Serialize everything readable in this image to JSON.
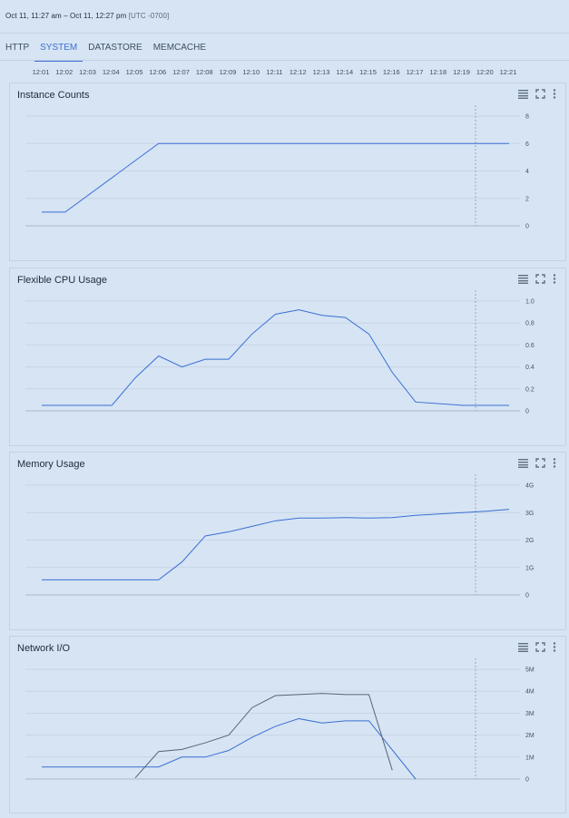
{
  "header": {
    "date_range": "Oct 11, 11:27 am – Oct 11, 12:27 pm",
    "timezone": "[UTC -0700]"
  },
  "tabs": [
    {
      "label": "HTTP",
      "active": false
    },
    {
      "label": "SYSTEM",
      "active": true
    },
    {
      "label": "DATASTORE",
      "active": false
    },
    {
      "label": "MEMCACHE",
      "active": false
    }
  ],
  "time_axis": [
    "12:01",
    "12:02",
    "12:03",
    "12:04",
    "12:05",
    "12:06",
    "12:07",
    "12:08",
    "12:09",
    "12:10",
    "12:11",
    "12:12",
    "12:13",
    "12:14",
    "12:15",
    "12:16",
    "12:17",
    "12:18",
    "12:19",
    "12:20",
    "12:21"
  ],
  "panel_icons": [
    "legend-icon",
    "fullscreen-icon",
    "more-vert-icon"
  ],
  "colors": {
    "line_primary": "#3b6fd1",
    "line_secondary": "#56657a",
    "grid": "#c6d4e5",
    "cursor": "#9aa9bb"
  },
  "chart_data": [
    {
      "title": "Instance Counts",
      "type": "line",
      "ylim": [
        0,
        8
      ],
      "yticks": [
        "0",
        "2",
        "4",
        "6",
        "8"
      ],
      "x": [
        "12:01",
        "12:02",
        "12:06",
        "12:21"
      ],
      "series": [
        {
          "values": [
            1,
            1,
            6,
            6
          ]
        }
      ]
    },
    {
      "title": "Flexible CPU Usage",
      "type": "line",
      "ylim": [
        0,
        1.0
      ],
      "yticks": [
        "0",
        "0.2",
        "0.4",
        "0.6",
        "0.8",
        "1.0"
      ],
      "x": [
        "12:01",
        "12:04",
        "12:05",
        "12:06",
        "12:07",
        "12:08",
        "12:09",
        "12:10",
        "12:11",
        "12:12",
        "12:13",
        "12:14",
        "12:15",
        "12:16",
        "12:17",
        "12:19",
        "12:21"
      ],
      "series": [
        {
          "values": [
            0.05,
            0.05,
            0.3,
            0.5,
            0.4,
            0.47,
            0.47,
            0.7,
            0.88,
            0.92,
            0.87,
            0.85,
            0.7,
            0.35,
            0.08,
            0.05,
            0.05
          ]
        }
      ]
    },
    {
      "title": "Memory Usage",
      "type": "line",
      "ylim": [
        0,
        4
      ],
      "yticks": [
        "0",
        "1G",
        "2G",
        "3G",
        "4G"
      ],
      "x": [
        "12:01",
        "12:06",
        "12:07",
        "12:08",
        "12:09",
        "12:10",
        "12:11",
        "12:12",
        "12:13",
        "12:14",
        "12:15",
        "12:16",
        "12:17",
        "12:18",
        "12:19",
        "12:20",
        "12:21"
      ],
      "series": [
        {
          "values": [
            0.55,
            0.55,
            1.2,
            2.15,
            2.3,
            2.5,
            2.7,
            2.8,
            2.8,
            2.82,
            2.8,
            2.82,
            2.9,
            2.95,
            3.0,
            3.05,
            3.12
          ]
        }
      ]
    },
    {
      "title": "Network I/O",
      "type": "line",
      "ylim": [
        0,
        5
      ],
      "yticks": [
        "0",
        "1M",
        "2M",
        "3M",
        "4M",
        "5M"
      ],
      "series": [
        {
          "x": [
            "12:01",
            "12:06",
            "12:07",
            "12:08",
            "12:09",
            "12:10",
            "12:11",
            "12:12",
            "12:13",
            "12:14",
            "12:15",
            "12:17"
          ],
          "values": [
            0.55,
            0.55,
            1.0,
            1.0,
            1.3,
            1.9,
            2.4,
            2.75,
            2.55,
            2.65,
            2.65,
            0
          ]
        },
        {
          "x": [
            "12:05",
            "12:06",
            "12:07",
            "12:08",
            "12:09",
            "12:10",
            "12:11",
            "12:12",
            "12:13",
            "12:14",
            "12:15",
            "12:16"
          ],
          "values": [
            0.05,
            1.25,
            1.35,
            1.65,
            2.0,
            3.25,
            3.8,
            3.85,
            3.9,
            3.85,
            3.85,
            0.4
          ]
        }
      ]
    }
  ]
}
